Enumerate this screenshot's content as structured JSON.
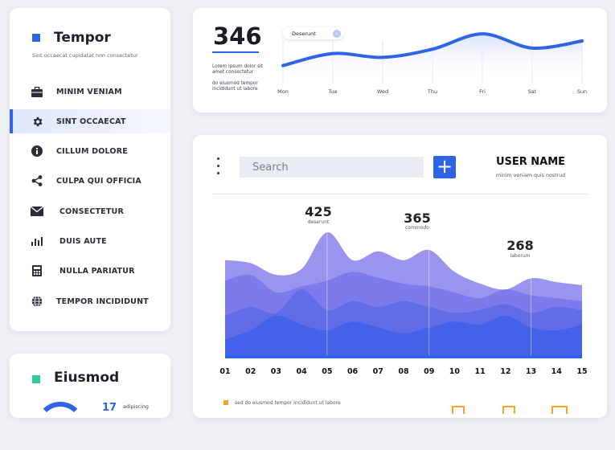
{
  "sidebar": {
    "brand_title": "Tempor",
    "brand_subtitle": "Sint occaecat cupidatat non consectetur",
    "accent": "#2f63e8",
    "items": [
      {
        "label": "MINIM VENIAM",
        "icon": "briefcase-icon"
      },
      {
        "label": "SINT OCCAECAT",
        "icon": "gear-icon",
        "active": true
      },
      {
        "label": "CILLUM DOLORE",
        "icon": "info-icon"
      },
      {
        "label": "CULPA QUI OFFICIA",
        "icon": "share-icon"
      },
      {
        "label": "CONSECTETUR",
        "icon": "mail-icon"
      },
      {
        "label": "DUIS AUTE",
        "icon": "bar-chart-icon"
      },
      {
        "label": "NULLA PARIATUR",
        "icon": "calculator-icon"
      },
      {
        "label": "TEMPOR INCIDIDUNT",
        "icon": "globe-icon"
      }
    ]
  },
  "sidebar2": {
    "title": "Eiusmod",
    "accent": "#2ec99a",
    "number": "17",
    "text": "adipiscing"
  },
  "top": {
    "stat_value": "346",
    "text1": "Lorem ipsum dolor sit amet consectetur",
    "text2": "do eiusmod tempor incididunt ut labore",
    "pill_label": "Deserunt",
    "pill_icon": "arrow-right-icon"
  },
  "main": {
    "search_placeholder": "Search",
    "add_icon": "plus-icon",
    "menu_icon": "vertical-dots-icon",
    "user_name": "USER NAME",
    "user_sub": "minim veniam quis nostrud",
    "legend_text": "sed do eiusmod tempor incididunt ut labore",
    "legend_color": "#f2a62a",
    "peaks": [
      {
        "value": "425",
        "label": "deserunt"
      },
      {
        "value": "365",
        "label": "commodo"
      },
      {
        "value": "268",
        "label": "laborum"
      }
    ]
  },
  "chart_data": [
    {
      "type": "line",
      "x": [
        "Mon",
        "Tue",
        "Wed",
        "Thu",
        "Fri",
        "Sat",
        "Sun"
      ],
      "series": [
        {
          "values": [
            30,
            52,
            45,
            60,
            88,
            62,
            75
          ]
        }
      ],
      "color": "#2f63e8"
    },
    {
      "type": "area",
      "x": [
        "01",
        "02",
        "03",
        "04",
        "05",
        "06",
        "07",
        "08",
        "09",
        "10",
        "11",
        "12",
        "13",
        "14",
        "15"
      ],
      "series": [
        {
          "values": [
            330,
            320,
            280,
            300,
            425,
            330,
            360,
            330,
            365,
            290,
            250,
            230,
            268,
            255,
            245
          ],
          "color": "#9b94ef"
        },
        {
          "values": [
            260,
            280,
            220,
            240,
            260,
            290,
            270,
            250,
            240,
            220,
            200,
            230,
            210,
            200,
            190
          ],
          "color": "#7877ea"
        },
        {
          "values": [
            140,
            170,
            150,
            230,
            160,
            190,
            170,
            190,
            170,
            150,
            160,
            180,
            150,
            170,
            160
          ],
          "color": "#5c6ae6"
        },
        {
          "values": [
            60,
            90,
            140,
            110,
            90,
            120,
            100,
            80,
            100,
            120,
            110,
            140,
            100,
            90,
            110
          ],
          "color": "#3e5fe9"
        }
      ],
      "ylim": [
        0,
        450
      ]
    }
  ]
}
